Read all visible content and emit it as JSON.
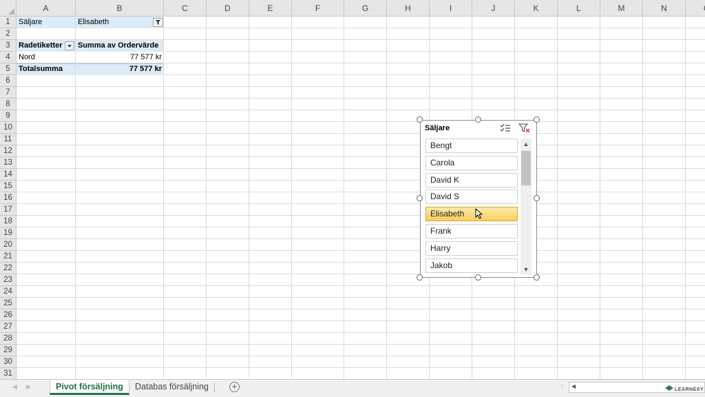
{
  "columns": [
    "A",
    "B",
    "C",
    "D",
    "E",
    "F",
    "G",
    "H",
    "I",
    "J",
    "K",
    "L",
    "M",
    "N",
    "O"
  ],
  "rows": [
    "1",
    "2",
    "3",
    "4",
    "5",
    "6",
    "7",
    "8",
    "9",
    "10",
    "11",
    "12",
    "13",
    "14",
    "15",
    "16",
    "17",
    "18",
    "19",
    "20",
    "21",
    "22",
    "23",
    "24",
    "25",
    "26",
    "27",
    "28",
    "29",
    "30",
    "31"
  ],
  "pivot": {
    "filter_label": "Säljare",
    "filter_value": "Elisabeth",
    "row_labels_header": "Radetiketter",
    "value_header": "Summa av Ordervärde",
    "row_label": "Nord",
    "row_value": "77 577 kr",
    "total_label": "Totalsumma",
    "total_value": "77 577 kr"
  },
  "slicer": {
    "title": "Säljare",
    "multi_select_icon": "multi-select-icon",
    "clear_filter_icon": "clear-filter-icon",
    "items": [
      {
        "label": "Bengt",
        "selected": false
      },
      {
        "label": "Carola",
        "selected": false
      },
      {
        "label": "David K",
        "selected": false
      },
      {
        "label": "David S",
        "selected": false
      },
      {
        "label": "Elisabeth",
        "selected": true
      },
      {
        "label": "Frank",
        "selected": false
      },
      {
        "label": "Harry",
        "selected": false
      },
      {
        "label": "Jakob",
        "selected": false
      }
    ]
  },
  "sheet_tabs": [
    {
      "label": "Pivot försäljning",
      "active": true
    },
    {
      "label": "Databas försäljning",
      "active": false
    }
  ],
  "logo_text": "LEARNESY",
  "colors": {
    "pivot_band": "#ddebf7",
    "active_tab": "#217346",
    "selected_item": "#f9cf5f"
  }
}
